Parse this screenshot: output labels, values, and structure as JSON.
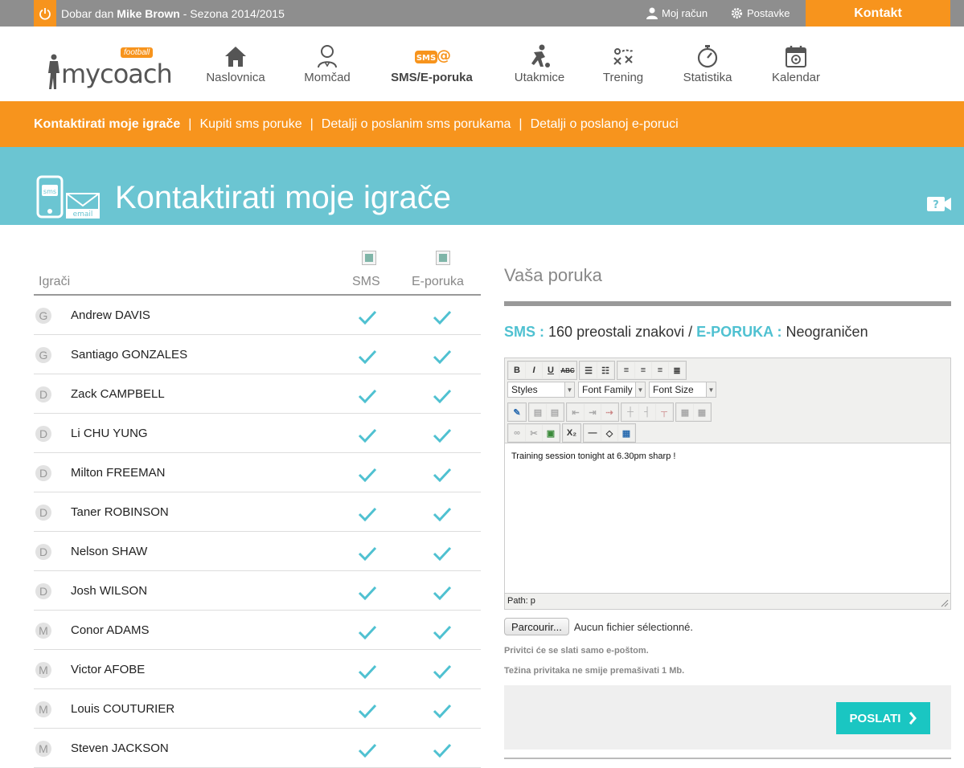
{
  "topbar": {
    "greeting_prefix": "Dobar dan",
    "user_name": "Mike Brown",
    "season": "- Sezona 2014/2015",
    "account_label": "Moj račun",
    "settings_label": "Postavke",
    "contact_label": "Kontakt"
  },
  "logo": {
    "text": "mycoach",
    "badge": "football"
  },
  "nav": [
    {
      "label": "Naslovnica",
      "icon": "home-icon"
    },
    {
      "label": "Momčad",
      "icon": "team-icon"
    },
    {
      "label": "SMS/E-poruka",
      "icon": "sms-email-icon",
      "active": true
    },
    {
      "label": "Utakmice",
      "icon": "match-icon"
    },
    {
      "label": "Trening",
      "icon": "training-icon"
    },
    {
      "label": "Statistika",
      "icon": "stopwatch-icon"
    },
    {
      "label": "Kalendar",
      "icon": "calendar-icon"
    }
  ],
  "subnav": [
    {
      "label": "Kontaktirati moje igrače",
      "active": true
    },
    {
      "label": "Kupiti sms poruke"
    },
    {
      "label": "Detalji o poslanim sms porukama"
    },
    {
      "label": "Detalji o poslanoj e-poruci"
    }
  ],
  "banner": {
    "title": "Kontaktirati moje igrače",
    "icon_sms": "sms",
    "icon_email": "email"
  },
  "players": {
    "header_label": "Igrači",
    "col_sms": "SMS",
    "col_email": "E-poruka",
    "rows": [
      {
        "pos": "G",
        "name": "Andrew DAVIS"
      },
      {
        "pos": "G",
        "name": "Santiago GONZALES"
      },
      {
        "pos": "D",
        "name": "Zack CAMPBELL"
      },
      {
        "pos": "D",
        "name": "Li CHU YUNG"
      },
      {
        "pos": "D",
        "name": "Milton FREEMAN"
      },
      {
        "pos": "D",
        "name": "Taner ROBINSON"
      },
      {
        "pos": "D",
        "name": "Nelson SHAW"
      },
      {
        "pos": "D",
        "name": "Josh WILSON"
      },
      {
        "pos": "M",
        "name": "Conor ADAMS"
      },
      {
        "pos": "M",
        "name": "Victor AFOBE"
      },
      {
        "pos": "M",
        "name": "Louis COUTURIER"
      },
      {
        "pos": "M",
        "name": "Steven JACKSON"
      }
    ]
  },
  "message": {
    "title": "Vaša poruka",
    "sms_label": "SMS :",
    "sms_remaining": "160 preostali znakovi /",
    "email_label": "E-PORUKA :",
    "email_limit": "Neograničen",
    "editor": {
      "styles": "Styles",
      "font_family": "Font Family",
      "font_size": "Font Size",
      "body": "Training session tonight at 6.30pm sharp !",
      "path": "Path: p"
    },
    "file_button": "Parcourir...",
    "file_status": "Aucun fichier sélectionné.",
    "note1": "Privitci će se slati samo e-poštom.",
    "note2": "Težina privitaka ne smije premašivati 1 Mb.",
    "send_label": "POSLATI"
  },
  "colors": {
    "orange": "#f7941d",
    "teal": "#6bc5d2",
    "check": "#4fc1d1",
    "send": "#1ac6c2"
  }
}
